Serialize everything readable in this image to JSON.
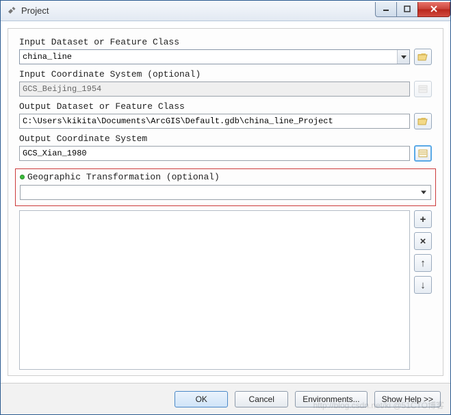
{
  "window": {
    "title": "Project"
  },
  "fields": {
    "input_dataset": {
      "label": "Input Dataset or Feature Class",
      "value": "china_line"
    },
    "input_cs": {
      "label": "Input Coordinate System (optional)",
      "value": "GCS_Beijing_1954"
    },
    "output_dataset": {
      "label": "Output Dataset or Feature Class",
      "value": "C:\\Users\\kikita\\Documents\\ArcGIS\\Default.gdb\\china_line_Project"
    },
    "output_cs": {
      "label": "Output Coordinate System",
      "value": "GCS_Xian_1980"
    },
    "transformation": {
      "label": "Geographic Transformation (optional)",
      "value": ""
    }
  },
  "buttons": {
    "ok": "OK",
    "cancel": "Cancel",
    "environments": "Environments...",
    "show_help": "Show Help >>"
  },
  "icons": {
    "add": "+",
    "remove": "×",
    "up": "↑",
    "down": "↓"
  },
  "watermark": "http://blog.csdn.net/ki @51CTO博客"
}
